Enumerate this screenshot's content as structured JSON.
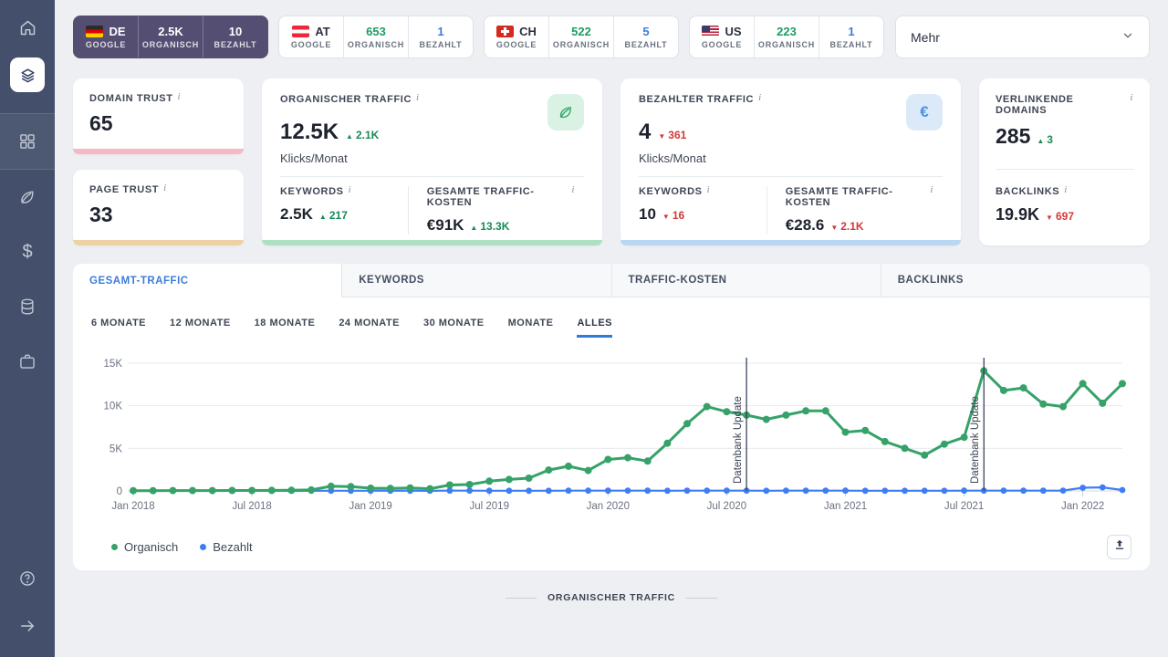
{
  "glyphs": {
    "up": "▲",
    "down": "▼"
  },
  "sidebar": {
    "items": [
      "home",
      "layers",
      "grid",
      "leaf",
      "dollar",
      "database",
      "briefcase",
      "help",
      "arrow-right"
    ]
  },
  "topbar": {
    "organic_label": "ORGANISCH",
    "paid_label": "BEZAHLT",
    "more_label": "Mehr",
    "countries": [
      {
        "code": "DE",
        "engine": "GOOGLE",
        "organic": "2.5K",
        "paid": "10",
        "active": true
      },
      {
        "code": "AT",
        "engine": "GOOGLE",
        "organic": "653",
        "paid": "1",
        "active": false
      },
      {
        "code": "CH",
        "engine": "GOOGLE",
        "organic": "522",
        "paid": "5",
        "active": false
      },
      {
        "code": "US",
        "engine": "GOOGLE",
        "organic": "223",
        "paid": "1",
        "active": false
      }
    ]
  },
  "cards": {
    "domain_trust": {
      "label": "DOMAIN TRUST",
      "value": "65",
      "accent": "#f5b8c4"
    },
    "page_trust": {
      "label": "PAGE TRUST",
      "value": "33",
      "accent": "#edd3a4"
    },
    "organic_traffic": {
      "label": "ORGANISCHER TRAFFIC",
      "value": "12.5K",
      "delta": "2.1K",
      "delta_dir": "up",
      "unit": "Klicks/Monat",
      "accent": "#aee0c3",
      "keywords_label": "KEYWORDS",
      "keywords_value": "2.5K",
      "keywords_delta": "217",
      "cost_label": "GESAMTE TRAFFIC-KOSTEN",
      "cost_value": "€91K",
      "cost_delta": "13.3K"
    },
    "paid_traffic": {
      "label": "BEZAHLTER TRAFFIC",
      "value": "4",
      "delta": "361",
      "delta_dir": "down",
      "unit": "Klicks/Monat",
      "accent": "#b9d7f3",
      "euro_icon": "€",
      "keywords_label": "KEYWORDS",
      "keywords_value": "10",
      "keywords_delta": "16",
      "cost_label": "GESAMTE TRAFFIC-KOSTEN",
      "cost_value": "€28.6",
      "cost_delta": "2.1K"
    },
    "linking_domains": {
      "label": "VERLINKENDE DOMAINS",
      "value": "285",
      "delta": "3",
      "backlinks_label": "BACKLINKS",
      "backlinks_value": "19.9K",
      "backlinks_delta": "697"
    }
  },
  "tabs": [
    {
      "label": "GESAMT-TRAFFIC",
      "active": true
    },
    {
      "label": "KEYWORDS",
      "active": false
    },
    {
      "label": "TRAFFIC-KOSTEN",
      "active": false
    },
    {
      "label": "BACKLINKS",
      "active": false
    }
  ],
  "ranges": [
    {
      "label": "6 MONATE",
      "active": false
    },
    {
      "label": "12 MONATE",
      "active": false
    },
    {
      "label": "18 MONATE",
      "active": false
    },
    {
      "label": "24 MONATE",
      "active": false
    },
    {
      "label": "30 MONATE",
      "active": false
    },
    {
      "label": "MONATE",
      "active": false
    },
    {
      "label": "ALLES",
      "active": true
    }
  ],
  "legend": [
    {
      "label": "Organisch",
      "color": "#36a269"
    },
    {
      "label": "Bezahlt",
      "color": "#3d7ef5"
    }
  ],
  "footer": {
    "section_label": "ORGANISCHER TRAFFIC"
  },
  "chart_data": {
    "type": "line",
    "title": "Gesamt-Traffic (Alles)",
    "ylim": [
      0,
      15000
    ],
    "y_tick_values": [
      0,
      5000,
      10000,
      15000
    ],
    "y_tick_labels": [
      "0",
      "5K",
      "10K",
      "15K"
    ],
    "x_tick_indices": [
      0,
      6,
      12,
      18,
      24,
      30,
      36,
      42,
      48
    ],
    "x_tick_labels": [
      "Jan 2018",
      "Jul 2018",
      "Jan 2019",
      "Jul 2019",
      "Jan 2020",
      "Jul 2020",
      "Jan 2021",
      "Jul 2021",
      "Jan 2022"
    ],
    "grid": true,
    "legend_position": "bottom-left",
    "series": [
      {
        "name": "Organisch",
        "color": "#36a269",
        "values": [
          30,
          35,
          40,
          40,
          45,
          50,
          55,
          60,
          80,
          120,
          550,
          500,
          320,
          300,
          350,
          260,
          700,
          750,
          1150,
          1350,
          1500,
          2450,
          2900,
          2400,
          3700,
          3900,
          3500,
          5600,
          7900,
          9900,
          9300,
          8900,
          8400,
          8900,
          9400,
          9400,
          6900,
          7100,
          5800,
          5000,
          4200,
          5500,
          6300,
          14100,
          11800,
          12100,
          10200,
          9900,
          12600,
          10300,
          12600
        ]
      },
      {
        "name": "Bezahlt",
        "color": "#3d7ef5",
        "values": [
          10,
          15,
          12,
          14,
          16,
          15,
          14,
          18,
          16,
          15,
          20,
          22,
          25,
          20,
          18,
          15,
          30,
          28,
          25,
          22,
          20,
          26,
          30,
          28,
          35,
          30,
          28,
          25,
          30,
          32,
          30,
          28,
          26,
          30,
          32,
          30,
          28,
          26,
          25,
          24,
          22,
          26,
          28,
          30,
          32,
          30,
          28,
          40,
          370,
          420,
          110
        ]
      }
    ],
    "annotations": [
      {
        "index": 31,
        "label": "Datenbank Update"
      },
      {
        "index": 43,
        "label": "Datenbank Update"
      }
    ]
  }
}
